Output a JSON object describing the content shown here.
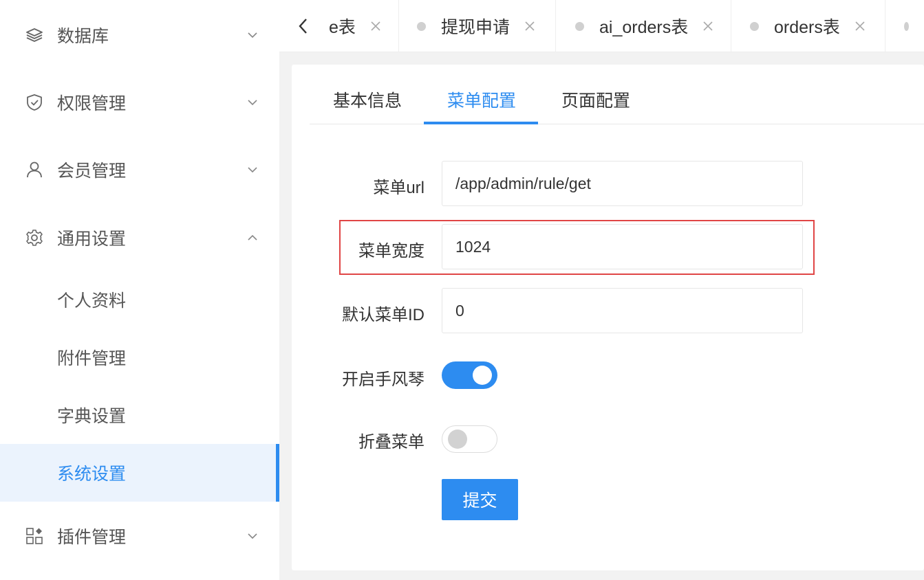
{
  "sidebar": {
    "items": [
      {
        "label": "数据库",
        "icon": "layers-icon",
        "arrow": "chevron-down-icon"
      },
      {
        "label": "权限管理",
        "icon": "shield-check-icon",
        "arrow": "chevron-down-icon"
      },
      {
        "label": "会员管理",
        "icon": "user-icon",
        "arrow": "chevron-down-icon"
      },
      {
        "label": "通用设置",
        "icon": "gear-icon",
        "arrow": "chevron-up-icon"
      },
      {
        "label": "个人资料"
      },
      {
        "label": "附件管理"
      },
      {
        "label": "字典设置"
      },
      {
        "label": "系统设置",
        "active": true
      },
      {
        "label": "插件管理",
        "icon": "apps-icon",
        "arrow": "chevron-down-icon"
      }
    ],
    "accent_color": "#2d8cf0"
  },
  "tabbar": {
    "tabs": [
      {
        "label": "e表"
      },
      {
        "label": "提现申请"
      },
      {
        "label": "ai_orders表"
      },
      {
        "label": "orders表"
      },
      {
        "label": ""
      }
    ]
  },
  "content_tabs": {
    "items": [
      "基本信息",
      "菜单配置",
      "页面配置"
    ],
    "active": "菜单配置"
  },
  "form": {
    "menu_url": {
      "label": "菜单url",
      "value": "/app/admin/rule/get"
    },
    "menu_width": {
      "label": "菜单宽度",
      "value": "1024"
    },
    "default_menu_id": {
      "label": "默认菜单ID",
      "value": "0"
    },
    "accordion": {
      "label": "开启手风琴",
      "on": true
    },
    "collapse_menu": {
      "label": "折叠菜单",
      "on": false
    },
    "submit_label": "提交"
  },
  "colors": {
    "primary": "#2d8cf0",
    "highlight": "#e04545"
  }
}
